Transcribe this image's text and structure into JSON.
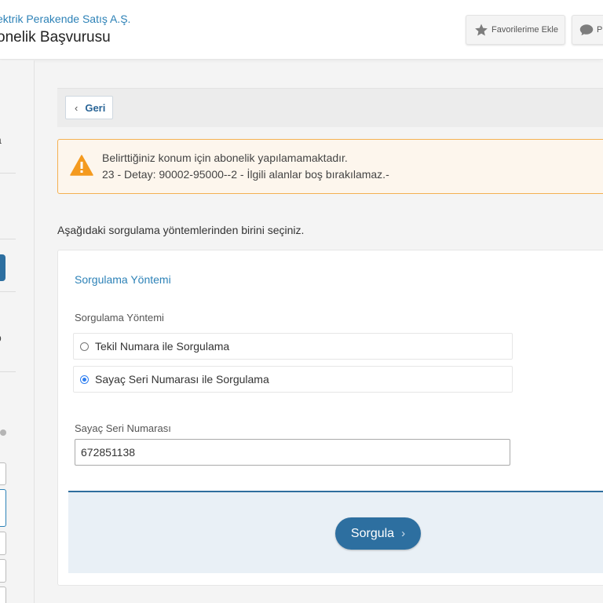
{
  "header": {
    "company": "ektrik Perakende Satış A.Ş.",
    "title": "onelik Başvurusu",
    "favorites_label": "Favorilerime Ekle",
    "messages_label": "P"
  },
  "sidebar": {
    "char_1": "a",
    "char_2": "o"
  },
  "back_button": {
    "label": "Geri"
  },
  "alert": {
    "line1": "Belirttiğiniz konum için abonelik yapılamamaktadır.",
    "line2": "23 - Detay: 90002-95000--2 - İlgili alanlar boş bırakılamaz.-",
    "color": "#f4b152"
  },
  "instruction": "Aşağıdaki sorgulama yöntemlerinden birini seçiniz.",
  "form": {
    "section_title": "Sorgulama Yöntemi",
    "method_label": "Sorgulama Yöntemi",
    "options": [
      {
        "label": "Tekil Numara ile Sorgulama",
        "selected": false
      },
      {
        "label": "Sayaç Seri Numarası ile Sorgulama",
        "selected": true
      }
    ],
    "serial_label": "Sayaç Seri Numarası",
    "serial_value": "672851138",
    "submit_label": "Sorgula"
  },
  "colors": {
    "primary": "#2d6fa0",
    "link": "#2d82b7",
    "radio_selected": "#2f7ff0"
  },
  "icons": {
    "favorites": "star-icon",
    "messages": "chat-bubble-icon",
    "back": "chevron-left-icon",
    "alert": "warning-triangle-icon",
    "submit": "chevron-right-icon"
  }
}
